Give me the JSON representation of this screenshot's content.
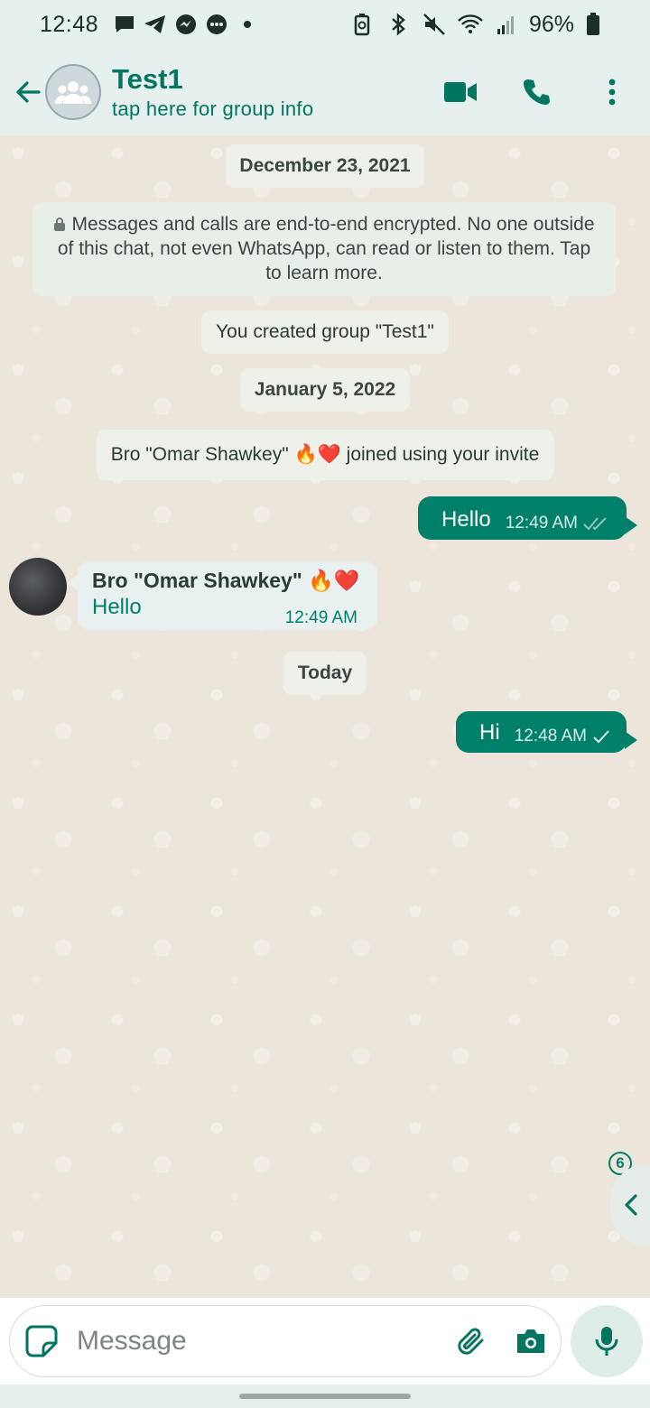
{
  "status_bar": {
    "time": "12:48",
    "battery": "96%",
    "icons": [
      "chat-notification-icon",
      "telegram-icon",
      "messenger-icon",
      "sms-icon",
      "dot-icon",
      "battery-saver-icon",
      "bluetooth-icon",
      "mute-icon",
      "wifi-icon",
      "signal-icon",
      "battery-icon"
    ]
  },
  "header": {
    "title": "Test1",
    "subtitle": "tap here for group info",
    "actions": [
      "video-call-icon",
      "voice-call-icon",
      "more-options-icon"
    ]
  },
  "chat": {
    "date_1": "December 23, 2021",
    "encryption_notice": "Messages and calls are end-to-end encrypted. No one outside of this chat, not even WhatsApp, can read or listen to them. Tap to learn more.",
    "created_notice": "You created group \"Test1\"",
    "date_2": "January 5, 2022",
    "joined_notice": "Bro \"Omar Shawkey\" 🔥❤️ joined using your invite",
    "outgoing_1": {
      "text": "Hello",
      "time": "12:49 AM",
      "status": "read"
    },
    "incoming_1": {
      "sender": "Bro \"Omar Shawkey\" 🔥❤️",
      "text": "Hello",
      "time": "12:49 AM"
    },
    "date_3": "Today",
    "outgoing_2": {
      "text": "Hi",
      "time": "12:48 AM",
      "status": "sent"
    },
    "unread_count": "6"
  },
  "composer": {
    "placeholder": "Message"
  },
  "colors": {
    "accent": "#00806b",
    "header_bg": "#e6f1ef",
    "chat_bg": "#ece5dc"
  }
}
